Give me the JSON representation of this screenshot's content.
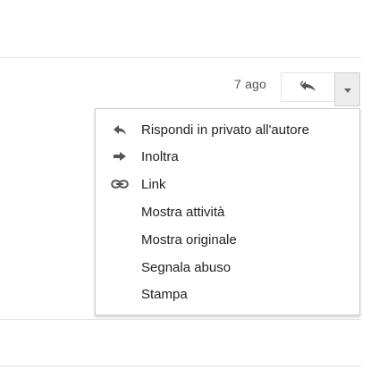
{
  "header": {
    "date": "7 ago",
    "reply_icon": "reply-all-icon",
    "more_icon": "chevron-down-icon"
  },
  "menu": {
    "items": [
      {
        "label": "Rispondi in privato all'autore",
        "icon": "reply-icon"
      },
      {
        "label": "Inoltra",
        "icon": "forward-icon"
      },
      {
        "label": "Link",
        "icon": "link-icon"
      },
      {
        "label": "Mostra attività",
        "icon": ""
      },
      {
        "label": "Mostra originale",
        "icon": ""
      },
      {
        "label": "Segnala abuso",
        "icon": ""
      },
      {
        "label": "Stampa",
        "icon": ""
      }
    ]
  }
}
